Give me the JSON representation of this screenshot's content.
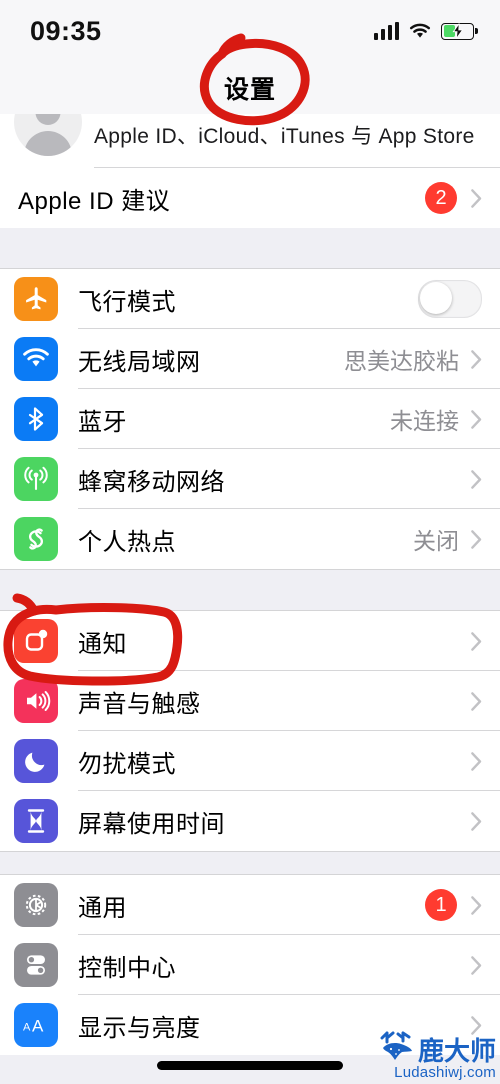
{
  "status_bar": {
    "time": "09:35",
    "signal_icon": "cellular-signal-icon",
    "wifi_icon": "wifi-icon",
    "battery_icon": "battery-charging-icon",
    "battery_level_percent": 35
  },
  "nav": {
    "title": "设置"
  },
  "apple_id": {
    "avatar_icon": "avatar-placeholder-icon",
    "subtitle": "Apple ID、iCloud、iTunes 与 App Store",
    "suggestion_label": "Apple ID 建议",
    "suggestion_badge": "2"
  },
  "groups": [
    {
      "name": "connectivity",
      "rows": [
        {
          "label": "飞行模式",
          "icon": "airplane-icon",
          "icon_color": "#f79018",
          "control": "toggle",
          "toggle_on": false
        },
        {
          "label": "无线局域网",
          "icon": "wifi-icon",
          "icon_color": "#0b7bf5",
          "value": "思美达胶粘",
          "control": "chevron"
        },
        {
          "label": "蓝牙",
          "icon": "bluetooth-icon",
          "icon_color": "#0b7bf5",
          "value": "未连接",
          "control": "chevron"
        },
        {
          "label": "蜂窝移动网络",
          "icon": "cellular-icon",
          "icon_color": "#4cd561",
          "value": "",
          "control": "chevron"
        },
        {
          "label": "个人热点",
          "icon": "hotspot-icon",
          "icon_color": "#4cd561",
          "value": "关闭",
          "control": "chevron"
        }
      ]
    },
    {
      "name": "alerts",
      "rows": [
        {
          "label": "通知",
          "icon": "notification-icon",
          "icon_color": "#fa4231",
          "value": "",
          "control": "chevron"
        },
        {
          "label": "声音与触感",
          "icon": "sound-haptics-icon",
          "icon_color": "#f4325b",
          "value": "",
          "control": "chevron"
        },
        {
          "label": "勿扰模式",
          "icon": "do-not-disturb-icon",
          "icon_color": "#5755d9",
          "value": "",
          "control": "chevron"
        },
        {
          "label": "屏幕使用时间",
          "icon": "screen-time-icon",
          "icon_color": "#5755d9",
          "value": "",
          "control": "chevron"
        }
      ]
    },
    {
      "name": "system",
      "rows": [
        {
          "label": "通用",
          "icon": "gear-icon",
          "icon_color": "#8e8e93",
          "badge": "1",
          "control": "chevron"
        },
        {
          "label": "控制中心",
          "icon": "control-center-icon",
          "icon_color": "#8e8e93",
          "value": "",
          "control": "chevron"
        },
        {
          "label": "显示与亮度",
          "icon": "display-brightness-icon",
          "icon_color": "#1a82fb",
          "value": "",
          "control": "chevron"
        }
      ]
    }
  ],
  "annotations": [
    {
      "name": "title-circle-annotation",
      "shape": "ellipse",
      "color": "#d81a12",
      "target": "设置"
    },
    {
      "name": "notifications-highlight-annotation",
      "shape": "rounded-rect",
      "color": "#d81a12",
      "target": "通知"
    }
  ],
  "watermark": {
    "logo_icon": "deer-logo-icon",
    "brand": "鹿大师",
    "url": "Ludashiwj.com",
    "color": "#1b63c4"
  }
}
